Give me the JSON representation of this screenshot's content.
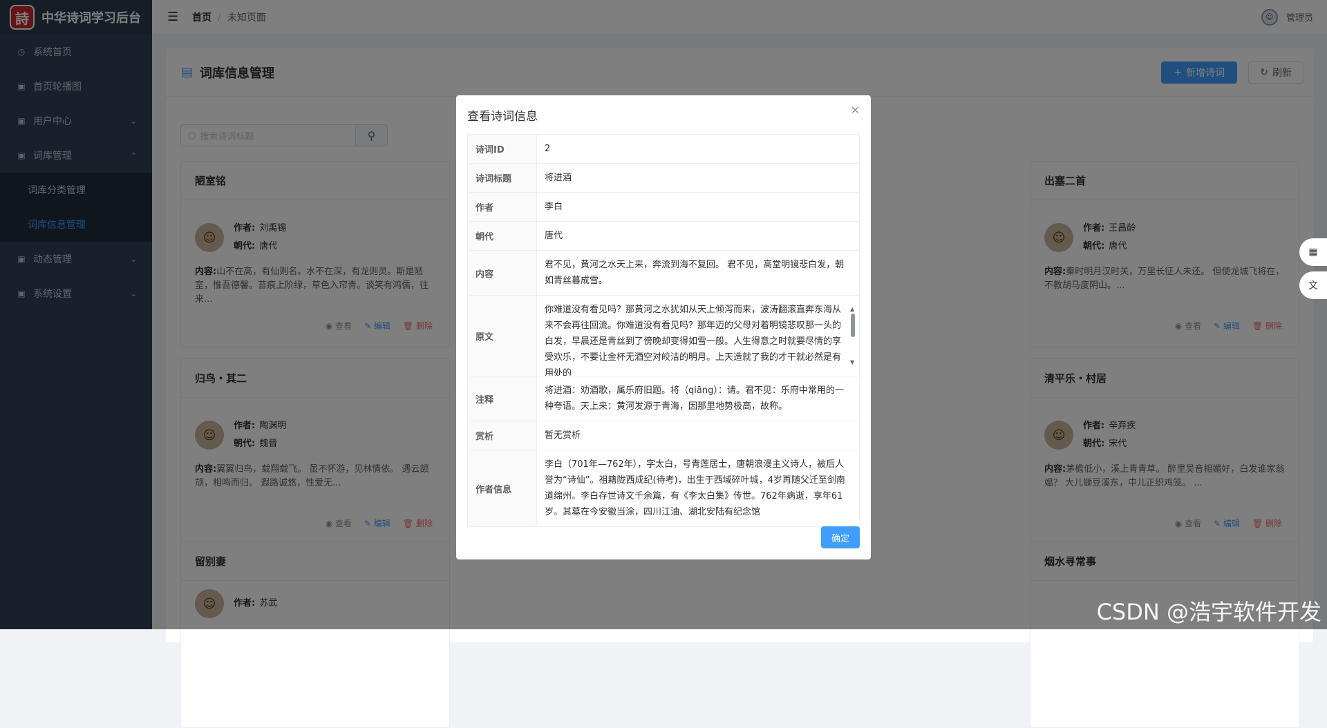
{
  "app": {
    "logo_char": "詩",
    "title": "中华诗词学习后台"
  },
  "sidebar": {
    "items": [
      {
        "label": "系统首页",
        "icon": "dashboard-icon"
      },
      {
        "label": "首页轮播图",
        "icon": "image-icon"
      },
      {
        "label": "用户中心",
        "icon": "user-icon",
        "arrow": "⌄"
      },
      {
        "label": "词库管理",
        "icon": "book-icon",
        "arrow": "⌃"
      },
      {
        "label": "动态管理",
        "icon": "chat-icon",
        "arrow": "⌄"
      },
      {
        "label": "系统设置",
        "icon": "gear-icon",
        "arrow": "⌄"
      }
    ],
    "sub": [
      "词库分类管理",
      "词库信息管理"
    ]
  },
  "topbar": {
    "crumb_home": "首页",
    "crumb_current": "未知页面",
    "user": "管理员"
  },
  "page": {
    "title": "词库信息管理",
    "add_label": "新增诗词",
    "refresh_label": "刷新",
    "search_placeholder": "搜索诗词标题"
  },
  "card_labels": {
    "author": "作者:",
    "dynasty": "朝代:",
    "content": "内容:",
    "view": "查看",
    "edit": "编辑",
    "delete": "删除"
  },
  "cards": [
    {
      "title": "陋室铭",
      "author": "刘禹锡",
      "dynasty": "唐代",
      "content": "山不在高，有仙则名。水不在深，有龙则灵。斯是陋室，惟吾德馨。苔痕上阶绿，草色入帘青。谈笑有鸿儒，往来..."
    },
    {
      "title": "出塞二首",
      "author": "王昌龄",
      "dynasty": "唐代",
      "content": "秦时明月汉时关，万里长征人未还。 但使龙城飞将在，不教胡马度阴山。..."
    },
    {
      "title": "归鸟・其二",
      "author": "陶渊明",
      "dynasty": "魏晋",
      "content": "翼翼归鸟，载翔载飞。 虽不怀游，见林情依。 遇云颉颃，相鸣而归。 遐路诚悠，性爱无..."
    },
    {
      "title": "清平乐・村居",
      "author": "辛弃疾",
      "dynasty": "宋代",
      "content": "茅檐低小，溪上青青草。 醉里吴音相媚好，白发谁家翁媪？ 大儿锄豆溪东，中儿正织鸡笼。 ..."
    },
    {
      "title": "留别妻",
      "author": "苏武"
    },
    {
      "title": "烟水寻常事"
    }
  ],
  "dialog": {
    "title": "查看诗词信息",
    "ok": "确定",
    "rows": {
      "id": {
        "k": "诗词ID",
        "v": "2"
      },
      "title": {
        "k": "诗词标题",
        "v": "将进酒"
      },
      "author": {
        "k": "作者",
        "v": "李白"
      },
      "dynasty": {
        "k": "朝代",
        "v": "唐代"
      },
      "content": {
        "k": "内容",
        "v": "君不见，黄河之水天上来，奔流到海不复回。 君不见，高堂明镜悲白发，朝如青丝暮成雪。"
      },
      "original": {
        "k": "原文",
        "v": "你难道没有看见吗？那黄河之水犹如从天上倾泻而来，波涛翻滚直奔东海从来不会再往回流。你难道没有看见吗？那年迈的父母对着明镜悲叹那一头的白发，早晨还是青丝到了傍晚却变得如雪一般。人生得意之时就要尽情的享受欢乐，不要让金杯无酒空对皎洁的明月。上天造就了我的才干就必然是有用处的"
      },
      "notes": {
        "k": "注释",
        "v": "将进酒：劝酒歌，属乐府旧题。将（qiāng）：请。君不见：乐府中常用的一种夸语。天上来：黄河发源于青海，因那里地势极高，故称。"
      },
      "appreciation": {
        "k": "赏析",
        "v": "暂无赏析"
      },
      "author_info": {
        "k": "作者信息",
        "v": "李白（701年—762年），字太白，号青莲居士，唐朝浪漫主义诗人，被后人誉为“诗仙”。祖籍陇西成纪(待考)，出生于西域碎叶城，4岁再随父迁至剑南道绵州。李白存世诗文千余篇，有《李太白集》传世。762年病逝，享年61岁。其墓在今安徽当涂，四川江油、湖北安陆有纪念馆"
      }
    }
  },
  "watermark": "CSDN @浩宇软件开发"
}
